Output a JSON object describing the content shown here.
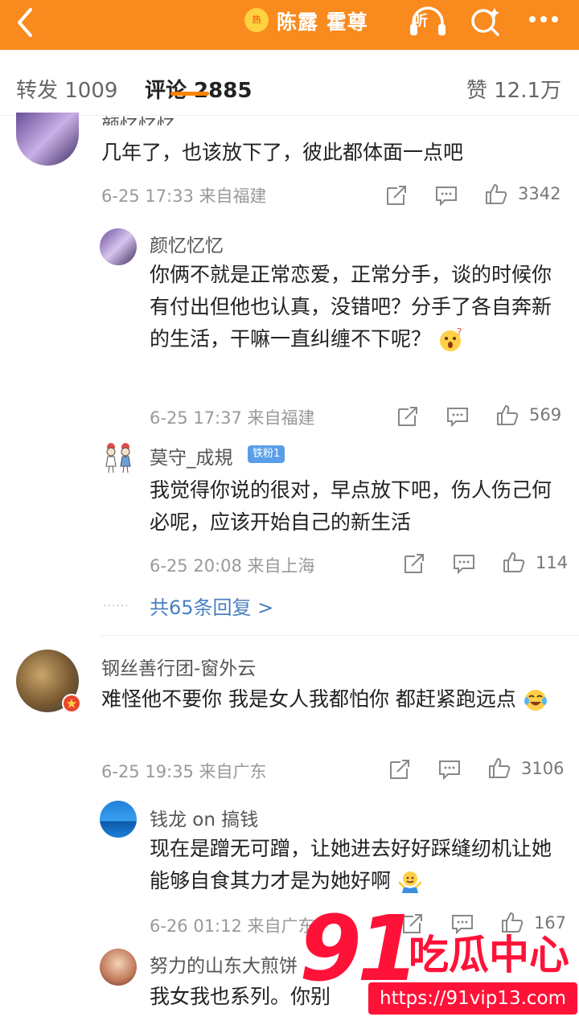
{
  "header": {
    "hot_badge": "热",
    "title": "陈露 霍尊",
    "listen_label": "听"
  },
  "tabs": {
    "repost": "转发 1009",
    "comment": "评论 2885",
    "likes": "赞 12.1万"
  },
  "comments": [
    {
      "name": "颜忆忆忆",
      "text": "几年了，也该放下了，彼此都体面一点吧",
      "meta": "6-25 17:33 来自福建",
      "likes": "3342",
      "replies": [
        {
          "name": "颜忆忆忆",
          "text": "你俩不就是正常恋爱，正常分手，谈的时候你有付出但他也认真，没错吧？分手了各自奔新的生活，干嘛一直纠缠不下呢？",
          "meta": "6-25 17:37 来自福建",
          "likes": "569"
        },
        {
          "name": "莫守_成規",
          "badge": "铁粉1",
          "text": "我觉得你说的很对，早点放下吧，伤人伤己何必呢，应该开始自己的新生活",
          "meta": "6-25 20:08 来自上海",
          "likes": "114"
        }
      ],
      "more_replies": "共65条回复 >"
    },
    {
      "name": "钢丝善行团-窗外云",
      "text": "难怪他不要你 我是女人我都怕你 都赶紧跑远点",
      "meta": "6-25 19:35 来自广东",
      "likes": "3106",
      "replies": [
        {
          "name": "钱龙 on 搞钱",
          "text": "现在是蹭无可蹭，让她进去好好踩缝纫机让她能够自食其力才是为她好啊",
          "meta": "6-26 01:12 来自广东",
          "likes": "167"
        },
        {
          "name": "努力的山东大煎饼",
          "text": "我女我也系列。你别"
        }
      ]
    }
  ],
  "watermark": {
    "number": "91",
    "brand": "吃瓜中心",
    "url": "https://91vip13.com"
  },
  "colors": {
    "header": "#f98a1d",
    "accent": "#ff8200",
    "link": "#4a7fc0",
    "watermark": "#ff1238"
  }
}
